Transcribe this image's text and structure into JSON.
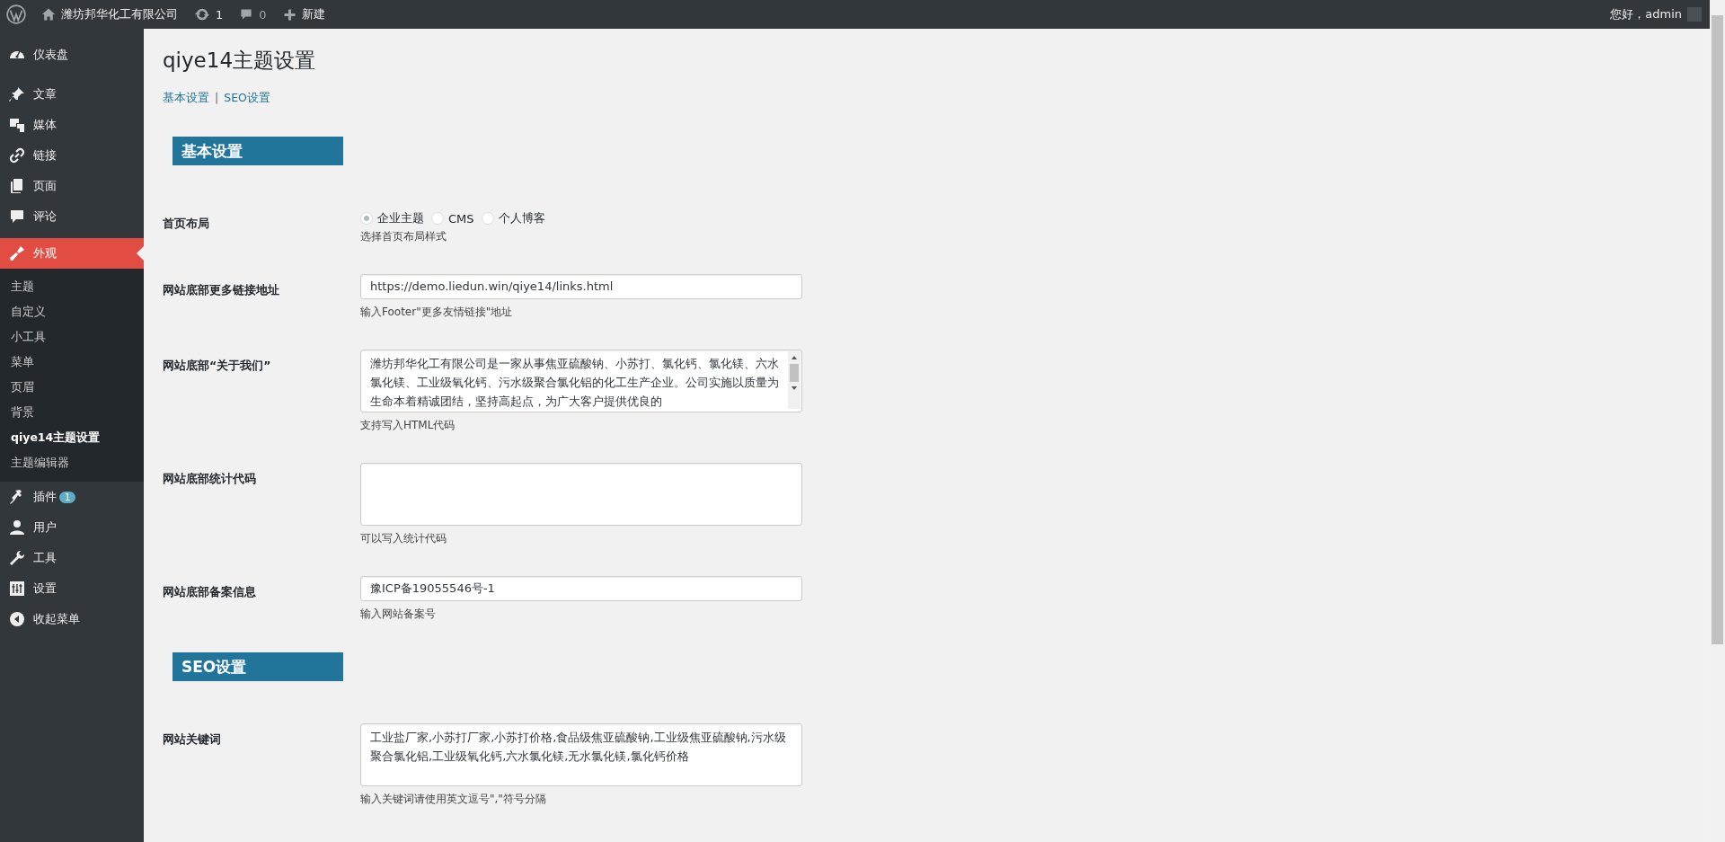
{
  "admin_bar": {
    "site_name": "潍坊邦华化工有限公司",
    "updates_count": "1",
    "comments_count": "0",
    "new_label": "新建",
    "greeting": "您好，admin"
  },
  "sidebar": {
    "items": [
      {
        "label": "仪表盘",
        "selected": false
      },
      {
        "label": "文章",
        "selected": false
      },
      {
        "label": "媒体",
        "selected": false
      },
      {
        "label": "链接",
        "selected": false
      },
      {
        "label": "页面",
        "selected": false
      },
      {
        "label": "评论",
        "selected": false
      },
      {
        "label": "外观",
        "selected": true,
        "children": [
          {
            "label": "主题",
            "selected": false
          },
          {
            "label": "自定义",
            "selected": false
          },
          {
            "label": "小工具",
            "selected": false
          },
          {
            "label": "菜单",
            "selected": false
          },
          {
            "label": "页眉",
            "selected": false
          },
          {
            "label": "背景",
            "selected": false
          },
          {
            "label": "qiye14主题设置",
            "selected": true
          },
          {
            "label": "主题编辑器",
            "selected": false
          }
        ]
      },
      {
        "label": "插件",
        "selected": false,
        "badge": "1"
      },
      {
        "label": "用户",
        "selected": false
      },
      {
        "label": "工具",
        "selected": false
      },
      {
        "label": "设置",
        "selected": false
      },
      {
        "label": "收起菜单",
        "selected": false
      }
    ]
  },
  "page": {
    "title": "qiye14主题设置",
    "subnav": [
      "基本设置",
      "SEO设置"
    ],
    "separator": "|",
    "sections": [
      {
        "heading": "基本设置",
        "fields": [
          {
            "kind": "radio",
            "label": "首页布局",
            "options": [
              {
                "label": "企业主题",
                "selected": true
              },
              {
                "label": "CMS",
                "selected": false
              },
              {
                "label": "个人博客",
                "selected": false
              }
            ],
            "hint": "选择首页布局样式"
          },
          {
            "kind": "line",
            "label": "网站底部更多链接地址",
            "value": "https://demo.liedun.win/qiye14/links.html",
            "hint": "输入Footer\"更多友情链接\"地址"
          },
          {
            "kind": "textarea",
            "label": "网站底部“关于我们”",
            "value": "潍坊邦华化工有限公司是一家从事焦亚硫酸钠、小苏打、氯化钙、氯化镁、六水氯化镁、工业级氧化钙、污水级聚合氯化铝的化工生产企业。公司实施以质量为生命本着精诚团结，坚持高起点，为广大客户提供优良的",
            "scrollbar": true,
            "hint": "支持写入HTML代码"
          },
          {
            "kind": "textarea",
            "label": "网站底部统计代码",
            "hint": "可以写入统计代码"
          },
          {
            "kind": "line",
            "label": "网站底部备案信息",
            "value": "豫ICP备19055546号-1",
            "hint": "输入网站备案号"
          }
        ]
      },
      {
        "heading": "SEO设置",
        "fields": [
          {
            "kind": "textarea",
            "label": "网站关键词",
            "value": "工业盐厂家,小苏打厂家,小苏打价格,食品级焦亚硫酸钠,工业级焦亚硫酸钠,污水级聚合氯化铝,工业级氧化钙,六水氯化镁,无水氯化镁,氯化钙价格",
            "hint": "输入关键词请使用英文逗号\",\"符号分隔"
          },
          {
            "kind": "cut"
          }
        ]
      }
    ]
  }
}
